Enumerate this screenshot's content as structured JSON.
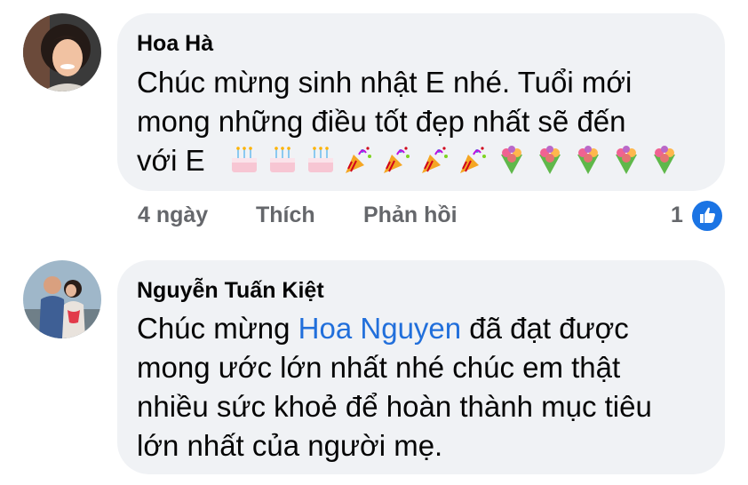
{
  "comments": [
    {
      "author": "Hoa Hà",
      "text_line1": "Chúc mừng sinh nhật E nhé. Tuổi mới",
      "text_line2": "mong những điều tốt đẹp nhất sẽ đến",
      "text_line3": "với E",
      "emojis": [
        "birthday-cake",
        "birthday-cake",
        "birthday-cake",
        "party-popper",
        "party-popper",
        "party-popper",
        "party-popper",
        "bouquet",
        "bouquet",
        "bouquet",
        "bouquet",
        "bouquet"
      ],
      "time": "4 ngày",
      "like_label": "Thích",
      "reply_label": "Phản hồi",
      "reaction_count": "1",
      "reaction_icon": "like-icon"
    },
    {
      "author": "Nguyễn Tuấn Kiệt",
      "text_before_mention": "Chúc mừng ",
      "mention": "Hoa Nguyen",
      "text_after_mention": " đã đạt được",
      "text_line2": "mong ước lớn nhất nhé chúc em thật",
      "text_line3": "nhiều sức khoẻ để hoàn thành mục tiêu",
      "text_line4": "lớn nhất của người mẹ."
    }
  ],
  "colors": {
    "bubble": "#f0f2f5",
    "mention": "#216fdb",
    "like_badge": "#1b74e4",
    "meta_text": "#65676b"
  }
}
